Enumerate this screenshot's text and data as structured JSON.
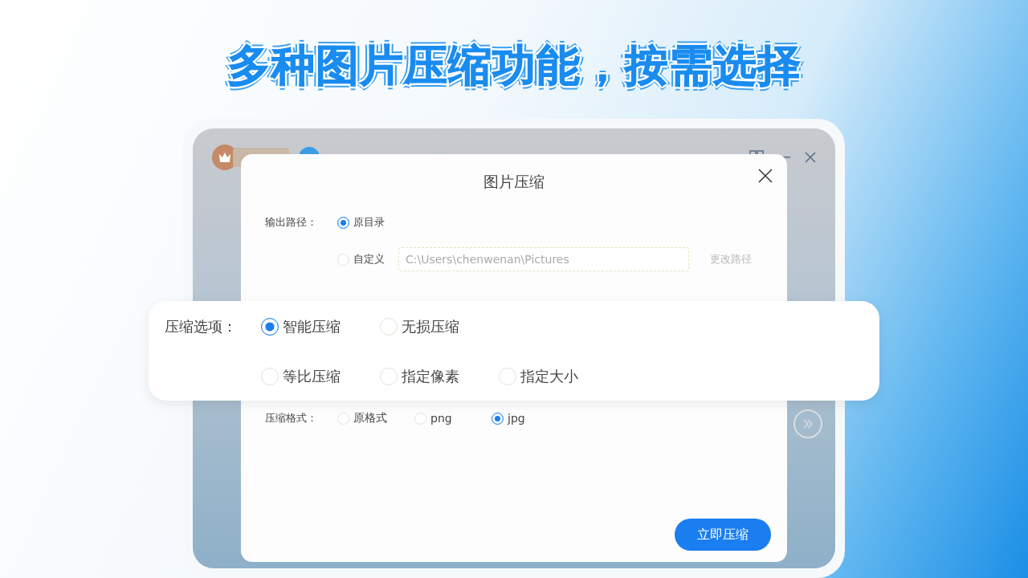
{
  "headline": "多种图片压缩功能，按需选择",
  "dialog": {
    "title": "图片压缩",
    "output_path": {
      "label": "输出路径：",
      "options": [
        {
          "label": "原目录",
          "selected": true
        },
        {
          "label": "自定义",
          "selected": false
        }
      ],
      "path_value": "C:\\Users\\chenwenan\\Pictures",
      "change_button": "更改路径"
    },
    "format": {
      "label": "压缩格式：",
      "options": [
        {
          "label": "原格式",
          "selected": false
        },
        {
          "label": "png",
          "selected": false
        },
        {
          "label": "jpg",
          "selected": true
        }
      ]
    },
    "submit": "立即压缩"
  },
  "compress_options": {
    "label": "压缩选项：",
    "rows": [
      [
        {
          "label": "智能压缩",
          "selected": true
        },
        {
          "label": "无损压缩",
          "selected": false
        }
      ],
      [
        {
          "label": "等比压缩",
          "selected": false
        },
        {
          "label": "指定像素",
          "selected": false
        },
        {
          "label": "指定大小",
          "selected": false
        }
      ]
    ]
  }
}
